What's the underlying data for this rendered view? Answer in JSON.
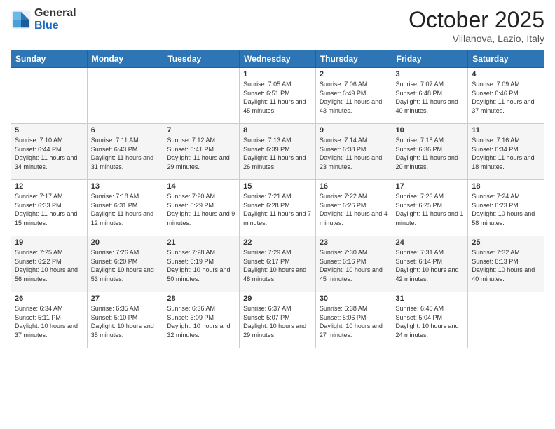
{
  "header": {
    "logo_general": "General",
    "logo_blue": "Blue",
    "month_title": "October 2025",
    "location": "Villanova, Lazio, Italy"
  },
  "days_of_week": [
    "Sunday",
    "Monday",
    "Tuesday",
    "Wednesday",
    "Thursday",
    "Friday",
    "Saturday"
  ],
  "weeks": [
    [
      {
        "day": "",
        "info": ""
      },
      {
        "day": "",
        "info": ""
      },
      {
        "day": "",
        "info": ""
      },
      {
        "day": "1",
        "info": "Sunrise: 7:05 AM\nSunset: 6:51 PM\nDaylight: 11 hours and 45 minutes."
      },
      {
        "day": "2",
        "info": "Sunrise: 7:06 AM\nSunset: 6:49 PM\nDaylight: 11 hours and 43 minutes."
      },
      {
        "day": "3",
        "info": "Sunrise: 7:07 AM\nSunset: 6:48 PM\nDaylight: 11 hours and 40 minutes."
      },
      {
        "day": "4",
        "info": "Sunrise: 7:09 AM\nSunset: 6:46 PM\nDaylight: 11 hours and 37 minutes."
      }
    ],
    [
      {
        "day": "5",
        "info": "Sunrise: 7:10 AM\nSunset: 6:44 PM\nDaylight: 11 hours and 34 minutes."
      },
      {
        "day": "6",
        "info": "Sunrise: 7:11 AM\nSunset: 6:43 PM\nDaylight: 11 hours and 31 minutes."
      },
      {
        "day": "7",
        "info": "Sunrise: 7:12 AM\nSunset: 6:41 PM\nDaylight: 11 hours and 29 minutes."
      },
      {
        "day": "8",
        "info": "Sunrise: 7:13 AM\nSunset: 6:39 PM\nDaylight: 11 hours and 26 minutes."
      },
      {
        "day": "9",
        "info": "Sunrise: 7:14 AM\nSunset: 6:38 PM\nDaylight: 11 hours and 23 minutes."
      },
      {
        "day": "10",
        "info": "Sunrise: 7:15 AM\nSunset: 6:36 PM\nDaylight: 11 hours and 20 minutes."
      },
      {
        "day": "11",
        "info": "Sunrise: 7:16 AM\nSunset: 6:34 PM\nDaylight: 11 hours and 18 minutes."
      }
    ],
    [
      {
        "day": "12",
        "info": "Sunrise: 7:17 AM\nSunset: 6:33 PM\nDaylight: 11 hours and 15 minutes."
      },
      {
        "day": "13",
        "info": "Sunrise: 7:18 AM\nSunset: 6:31 PM\nDaylight: 11 hours and 12 minutes."
      },
      {
        "day": "14",
        "info": "Sunrise: 7:20 AM\nSunset: 6:29 PM\nDaylight: 11 hours and 9 minutes."
      },
      {
        "day": "15",
        "info": "Sunrise: 7:21 AM\nSunset: 6:28 PM\nDaylight: 11 hours and 7 minutes."
      },
      {
        "day": "16",
        "info": "Sunrise: 7:22 AM\nSunset: 6:26 PM\nDaylight: 11 hours and 4 minutes."
      },
      {
        "day": "17",
        "info": "Sunrise: 7:23 AM\nSunset: 6:25 PM\nDaylight: 11 hours and 1 minute."
      },
      {
        "day": "18",
        "info": "Sunrise: 7:24 AM\nSunset: 6:23 PM\nDaylight: 10 hours and 58 minutes."
      }
    ],
    [
      {
        "day": "19",
        "info": "Sunrise: 7:25 AM\nSunset: 6:22 PM\nDaylight: 10 hours and 56 minutes."
      },
      {
        "day": "20",
        "info": "Sunrise: 7:26 AM\nSunset: 6:20 PM\nDaylight: 10 hours and 53 minutes."
      },
      {
        "day": "21",
        "info": "Sunrise: 7:28 AM\nSunset: 6:19 PM\nDaylight: 10 hours and 50 minutes."
      },
      {
        "day": "22",
        "info": "Sunrise: 7:29 AM\nSunset: 6:17 PM\nDaylight: 10 hours and 48 minutes."
      },
      {
        "day": "23",
        "info": "Sunrise: 7:30 AM\nSunset: 6:16 PM\nDaylight: 10 hours and 45 minutes."
      },
      {
        "day": "24",
        "info": "Sunrise: 7:31 AM\nSunset: 6:14 PM\nDaylight: 10 hours and 42 minutes."
      },
      {
        "day": "25",
        "info": "Sunrise: 7:32 AM\nSunset: 6:13 PM\nDaylight: 10 hours and 40 minutes."
      }
    ],
    [
      {
        "day": "26",
        "info": "Sunrise: 6:34 AM\nSunset: 5:11 PM\nDaylight: 10 hours and 37 minutes."
      },
      {
        "day": "27",
        "info": "Sunrise: 6:35 AM\nSunset: 5:10 PM\nDaylight: 10 hours and 35 minutes."
      },
      {
        "day": "28",
        "info": "Sunrise: 6:36 AM\nSunset: 5:09 PM\nDaylight: 10 hours and 32 minutes."
      },
      {
        "day": "29",
        "info": "Sunrise: 6:37 AM\nSunset: 5:07 PM\nDaylight: 10 hours and 29 minutes."
      },
      {
        "day": "30",
        "info": "Sunrise: 6:38 AM\nSunset: 5:06 PM\nDaylight: 10 hours and 27 minutes."
      },
      {
        "day": "31",
        "info": "Sunrise: 6:40 AM\nSunset: 5:04 PM\nDaylight: 10 hours and 24 minutes."
      },
      {
        "day": "",
        "info": ""
      }
    ]
  ]
}
